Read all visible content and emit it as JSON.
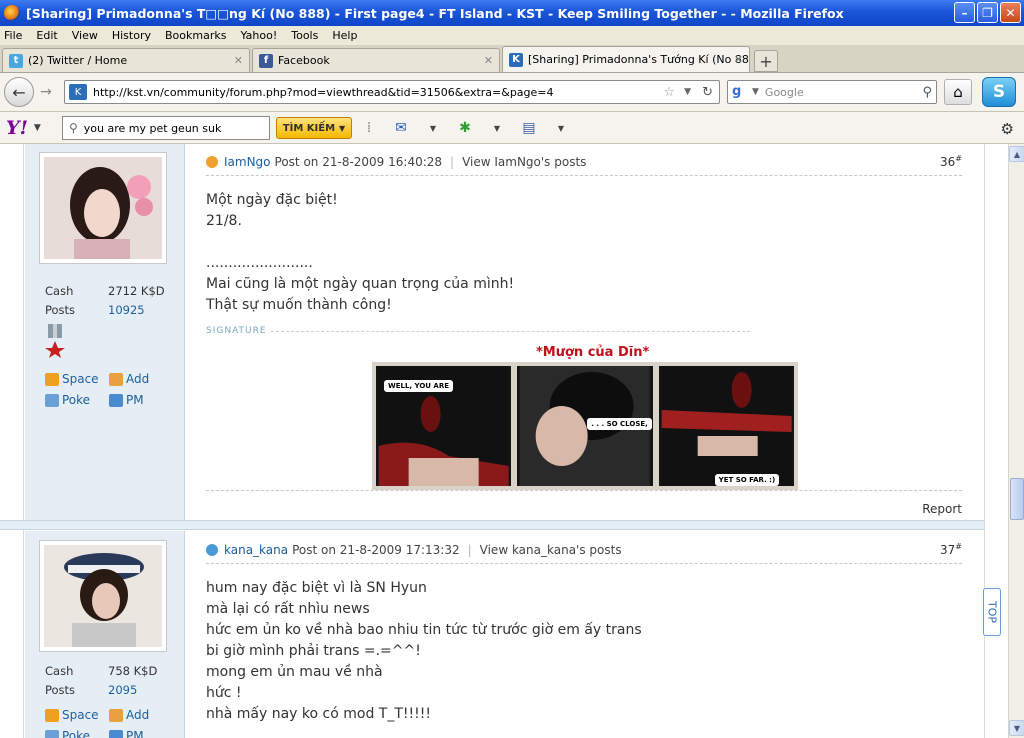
{
  "window": {
    "title": "[Sharing] Primadonna's T□□ng Kí (No 888) - First page4 - FT Island - KST - Keep Smiling Together - - Mozilla Firefox",
    "minimize": "–",
    "restore": "❐",
    "close": "✕"
  },
  "menu": [
    "File",
    "Edit",
    "View",
    "History",
    "Bookmarks",
    "Yahoo!",
    "Tools",
    "Help"
  ],
  "tabs": [
    {
      "label": "(2) Twitter / Home",
      "close": "✕"
    },
    {
      "label": "Facebook",
      "close": "✕"
    },
    {
      "label": "[Sharing] Primadonna's Tướng Kí (No 888...",
      "close": "✕"
    }
  ],
  "nav": {
    "url": "http://kst.vn/community/forum.php?mod=viewthread&tid=31506&extra=&page=4",
    "search_placeholder": "Google"
  },
  "yahoo": {
    "logo": "Y!",
    "search_value": "you are my pet geun suk",
    "search_button": "TÌM KIẾM"
  },
  "posts": [
    {
      "author": "IamNgo",
      "posted": "Post on 21-8-2009 16:40:28",
      "view": "View IamNgo's posts",
      "num": "36",
      "lines": [
        "Một ngày đặc biệt!",
        "21/8.",
        "",
        "........................",
        "Mai cũng là một ngày quan trọng của mình!",
        "Thật sự muốn thành công!"
      ],
      "cash_label": "Cash",
      "cash": "2712 K$D",
      "posts_label": "Posts",
      "posts": "10925",
      "signature_label": "SIGNATURE",
      "sig_title": "*Mượn của Dĩn*",
      "captions": [
        "WELL, YOU ARE",
        ". . . SO CLOSE,",
        "YET SO FAR. :)"
      ],
      "report": "Report"
    },
    {
      "author": "kana_kana",
      "posted": "Post on 21-8-2009 17:13:32",
      "view": "View kana_kana's posts",
      "num": "37",
      "lines": [
        "hum nay đặc biệt vì là SN Hyun",
        "mà lại có rất nhìu news",
        "hức em ủn ko về nhà bao nhiu tin tức từ trước giờ em ấy trans",
        "bi giờ mình phải trans =.=^^!",
        "mong em ủn mau về nhà",
        "hức !",
        "nhà mấy nay ko có mod T_T!!!!!"
      ],
      "cash_label": "Cash",
      "cash": "758 K$D",
      "posts_label": "Posts",
      "posts": "2095"
    }
  ],
  "profile_links": {
    "space": "Space",
    "add": "Add",
    "poke": "Poke",
    "pm": "PM"
  },
  "backtop": "TOP"
}
